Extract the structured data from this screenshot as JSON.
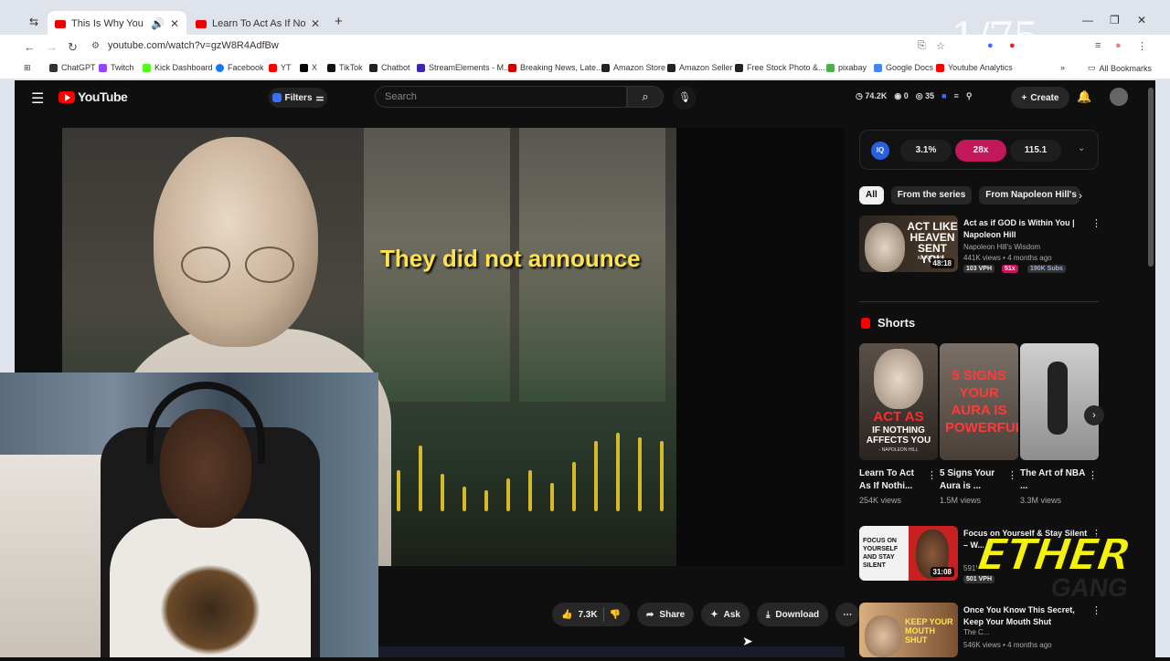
{
  "browser": {
    "tabs": [
      {
        "label": "This Is Why You Must Stay"
      },
      {
        "label": "Learn To Act As If Nothing Both"
      }
    ],
    "new_tab": "+",
    "url": "youtube.com/watch?v=gzW8R4AdfBw",
    "bookmarks": [
      {
        "label": "ChatGPT",
        "color": "#333333"
      },
      {
        "label": "Twitch",
        "color": "#9146ff"
      },
      {
        "label": "Kick Dashboard",
        "color": "#53fc18"
      },
      {
        "label": "Facebook",
        "color": "#1877f2"
      },
      {
        "label": "YT",
        "color": "#ff0000"
      },
      {
        "label": "X",
        "color": "#000000"
      },
      {
        "label": "TikTok",
        "color": "#111111"
      },
      {
        "label": "Chatbot",
        "color": "#222222"
      },
      {
        "label": "StreamElements - M...",
        "color": "#3a2ab0"
      },
      {
        "label": "Breaking News, Late...",
        "color": "#cc0000"
      },
      {
        "label": "Amazon Store",
        "color": "#222222"
      },
      {
        "label": "Amazon Seller",
        "color": "#222222"
      },
      {
        "label": "Free Stock Photo &...",
        "color": "#222222"
      },
      {
        "label": "pixabay",
        "color": "#4caf50"
      },
      {
        "label": "Google Docs",
        "color": "#4285f4"
      },
      {
        "label": "Youtube Analytics",
        "color": "#ff0000"
      }
    ],
    "all_bookmarks": "All Bookmarks",
    "page_counter": "1/75"
  },
  "youtube": {
    "logo": "YouTube",
    "filters": "Filters",
    "search_placeholder": "Search",
    "stats": [
      "74.2K",
      "0",
      "35"
    ],
    "create": "Create"
  },
  "player": {
    "caption": "They did not announce",
    "audio_bars": [
      0.5,
      0.8,
      0.45,
      0.3,
      0.25,
      0.4,
      0.5,
      0.35,
      0.6,
      0.85,
      0.95,
      0.9,
      0.85
    ]
  },
  "actions": {
    "likes": "7.3K",
    "share": "Share",
    "ask": "Ask",
    "download": "Download"
  },
  "sidebar": {
    "iq_badge": "IQ",
    "iq_pills": [
      "3.1%",
      "28x",
      "115.1"
    ],
    "chips": [
      "All",
      "From the series",
      "From Napoleon Hill's Wis"
    ],
    "top_rec": {
      "thumb_text": "ACT LIKE HEAVEN SENT YOU",
      "thumb_sub": "NAPOLEON",
      "duration": "48:18",
      "title": "Act as if GOD is Within You | Napoleon Hill",
      "channel": "Napoleon Hill's Wisdom",
      "meta": "441K views • 4 months ago",
      "tags": [
        "103 VPH",
        "51x",
        "190K Subs"
      ]
    },
    "shorts_title": "Shorts",
    "shorts": [
      {
        "title": "Learn To Act As If Nothi...",
        "views": "254K views",
        "thumb_text": "ACT AS",
        "thumb_text2": "IF NOTHING AFFECTS YOU",
        "thumb_sub": "- NAPOLEON HILL"
      },
      {
        "title": "5 Signs Your Aura is ...",
        "views": "1.5M views",
        "thumb_text": "5 SIGNS YOUR AURA IS POWERFUL"
      },
      {
        "title": "The Art of NBA ...",
        "views": "3.3M views"
      }
    ],
    "recs": [
      {
        "title": "Focus on Yourself & Stay Silent – W...",
        "meta": "591K views",
        "thumb_text": "FOCUS ON YOURSELF AND STAY SILENT",
        "duration": "31:08",
        "tag": "501 VPH"
      },
      {
        "title": "Once You Know This Secret, Keep Your Mouth Shut",
        "meta": "546K views • 4 months ago",
        "channel": "The C...",
        "thumb_text": "KEEP YOUR MOUTH SHUT"
      }
    ],
    "overlay": "ETHER",
    "overlay_sub": "GANG"
  }
}
